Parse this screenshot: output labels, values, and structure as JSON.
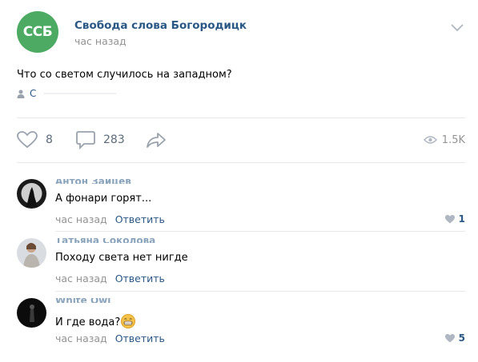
{
  "post": {
    "group_avatar_text": "ССБ",
    "group_name": "Свобода слова Богородицк",
    "time": "час назад",
    "text": "Что со светом случилось на западном?",
    "signer": "С",
    "likes": "8",
    "comments": "283",
    "views": "1.5K"
  },
  "comments": [
    {
      "author": "Антон Зайцев",
      "text": "А фонари горят...",
      "time": "час назад",
      "reply": "Ответить",
      "likes": "1"
    },
    {
      "author": "Татьяна Соколова",
      "text": "Походу света нет нигде",
      "time": "час назад",
      "reply": "Ответить",
      "likes": ""
    },
    {
      "author": "White Owl",
      "text": "И где вода?",
      "time": "час назад",
      "reply": "Ответить",
      "likes": "5"
    }
  ],
  "colors": {
    "link": "#2a5885",
    "muted": "#939393",
    "accent_green": "#4caa63",
    "divider": "#e7e8ec"
  },
  "icons": [
    "chevron-down-icon",
    "user-icon",
    "heart-icon",
    "comment-icon",
    "share-icon",
    "eye-icon",
    "grinning-emoji-icon"
  ]
}
